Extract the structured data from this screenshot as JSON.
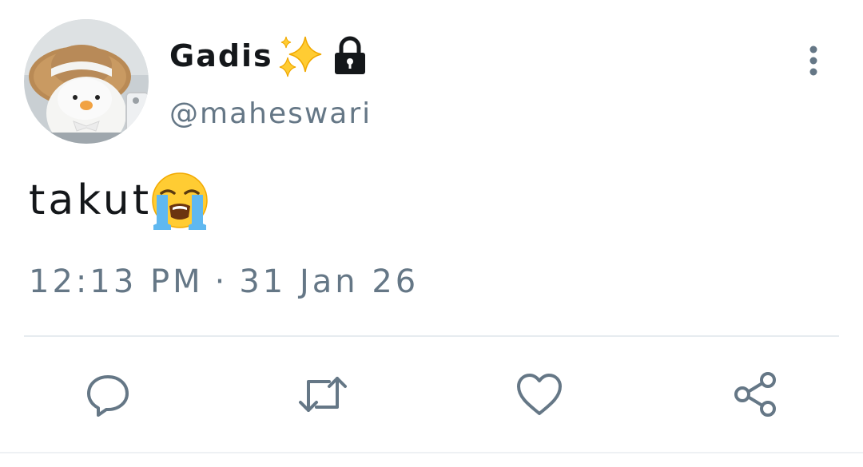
{
  "tweet": {
    "display_name": "Gadis",
    "name_emoji": "sparkles-emoji",
    "name_badge_icon": "lock-icon",
    "username": "@maheswari",
    "text": "takut",
    "text_emoji": "loudly-crying-face-emoji",
    "time": "12:13 PM",
    "separator": "·",
    "date": "31 Jan 26"
  },
  "actions": [
    {
      "name": "reply",
      "icon": "speech-bubble-icon"
    },
    {
      "name": "retweet",
      "icon": "retweet-arrows-icon"
    },
    {
      "name": "like",
      "icon": "heart-icon"
    },
    {
      "name": "share",
      "icon": "share-icon"
    }
  ],
  "more_menu_icon": "vertical-dots-icon",
  "colors": {
    "primary_text": "#14171a",
    "secondary_text": "#657786",
    "icon": "#657786",
    "divider": "#e6ecf0",
    "background": "#ffffff"
  }
}
